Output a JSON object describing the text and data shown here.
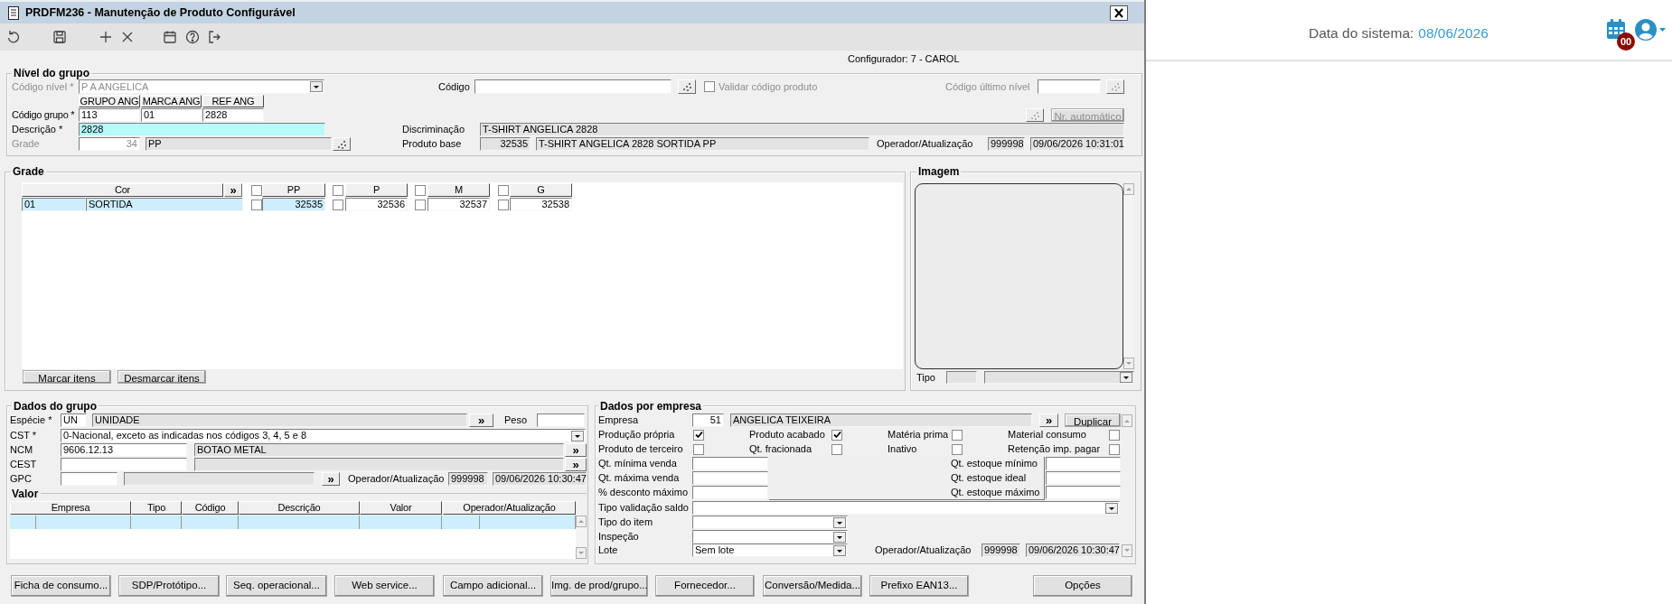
{
  "window": {
    "title": "PRDFM236 - Manutenção de Produto Configurável"
  },
  "toolbar": [
    {
      "kind": "undo"
    },
    {
      "kind": "save"
    },
    {
      "kind": "add"
    },
    {
      "kind": "delete"
    },
    {
      "kind": "calendar"
    },
    {
      "kind": "help"
    },
    {
      "kind": "exit"
    }
  ],
  "configurador": "Configurador: 7 - CAROL",
  "nivel_do_grupo": {
    "title": "Nível do grupo",
    "codigo_nivel": {
      "label": "Código nível *",
      "value": "P A ANGELICA",
      "disabled": true
    },
    "codigo": {
      "label": "Código"
    },
    "validar_codigo_produto": {
      "label": "Validar código produto",
      "checked": false,
      "disabled": true
    },
    "codigo_ultimo_nivel": {
      "label": "Código último nível",
      "disabled": true
    },
    "codigo_grupo": {
      "label": "Código grupo *",
      "columns": [
        "GRUPO ANG",
        "MARCA ANG",
        "REF ANG"
      ],
      "values": [
        "113",
        "01",
        "2828"
      ]
    },
    "nr_automatico": {
      "label": "Nr. automático",
      "disabled": true
    },
    "descricao": {
      "label": "Descrição *",
      "value": "2828"
    },
    "discriminacao": {
      "label": "Discriminação",
      "value": "T-SHIRT ANGELICA 2828"
    },
    "grade": {
      "label": "Grade",
      "code": "34",
      "name": "PP",
      "disabled": true
    },
    "produto_base": {
      "label": "Produto base",
      "code": "32535",
      "name": "T-SHIRT ANGELICA 2828 SORTIDA PP"
    },
    "operador_atualizacao": {
      "label": "Operador/Atualização",
      "operator": "999998",
      "timestamp": "09/06/2026 10:31:01"
    }
  },
  "grade": {
    "title": "Grade",
    "expand": "»",
    "columns": [
      {
        "kind": "color",
        "label": "Cor"
      },
      {
        "kind": "size",
        "label": "PP",
        "checked": false
      },
      {
        "kind": "size",
        "label": "P",
        "checked": false
      },
      {
        "kind": "size",
        "label": "M",
        "checked": false
      },
      {
        "kind": "size",
        "label": "G",
        "checked": false
      }
    ],
    "rows": [
      {
        "code": "01",
        "name": "SORTIDA",
        "selected": true,
        "cells": [
          {
            "value": "32535",
            "checked": false,
            "selected": true
          },
          {
            "value": "32536",
            "checked": false,
            "selected": false
          },
          {
            "value": "32537",
            "checked": false,
            "selected": false
          },
          {
            "value": "32538",
            "checked": false,
            "selected": false
          }
        ]
      }
    ],
    "buttons": [
      "Marcar itens",
      "Desmarcar itens"
    ]
  },
  "imagem": {
    "title": "Imagem",
    "tipo": {
      "label": "Tipo"
    }
  },
  "dados_do_grupo": {
    "title": "Dados do grupo",
    "especie": {
      "label": "Espécie *",
      "code": "UN",
      "name": "UNIDADE",
      "expand": "»"
    },
    "peso": {
      "label": "Peso"
    },
    "cst": {
      "label": "CST *",
      "value": "0-Nacional, exceto as indicadas nos códigos 3, 4, 5 e 8"
    },
    "ncm": {
      "label": "NCM",
      "code": "9606.12.13",
      "name": "BOTAO METAL",
      "expand": "»"
    },
    "cest": {
      "label": "CEST",
      "expand": "»"
    },
    "gpc": {
      "label": "GPC",
      "expand": "»"
    },
    "operador_atualizacao": {
      "label": "Operador/Atualização",
      "operator": "999998",
      "timestamp": "09/06/2026 10:30:47"
    }
  },
  "valor": {
    "title": "Valor",
    "columns": [
      "Empresa",
      "Tipo",
      "Código",
      "Descrição",
      "Valor",
      "Operador/Atualização"
    ],
    "rows": [
      {
        "selected": true
      }
    ]
  },
  "dados_por_empresa": {
    "title": "Dados por empresa",
    "empresa": {
      "label": "Empresa",
      "code": "51",
      "name": "ANGELICA TEIXEIRA",
      "expand": "»"
    },
    "duplicar": "Duplicar",
    "flags": [
      {
        "label": "Produção própria",
        "checked": true
      },
      {
        "label": "Produto acabado",
        "checked": true
      },
      {
        "label": "Matéria prima",
        "checked": false
      },
      {
        "label": "Material consumo",
        "checked": false
      },
      {
        "label": "Produto de terceiro",
        "checked": false
      },
      {
        "label": "Qt. fracionada",
        "checked": false
      },
      {
        "label": "Inativo",
        "checked": false
      },
      {
        "label": "Retenção imp. pagar",
        "checked": false
      }
    ],
    "limits": [
      {
        "label": "Qt. mínima venda"
      },
      {
        "label": "Qt. máxima venda"
      },
      {
        "label": "% desconto máximo"
      }
    ],
    "stock": [
      {
        "label": "Qt. estoque mínimo"
      },
      {
        "label": "Qt. estoque ideal"
      },
      {
        "label": "Qt. estoque máximo"
      }
    ],
    "tipo_validacao_saldo": {
      "label": "Tipo validação saldo"
    },
    "tipo_do_item": {
      "label": "Tipo do item"
    },
    "inspecao": {
      "label": "Inspeção"
    },
    "lote": {
      "label": "Lote",
      "value": "Sem lote"
    },
    "operador_atualizacao": {
      "label": "Operador/Atualização",
      "operator": "999998",
      "timestamp": "09/06/2026 10:30:47"
    }
  },
  "actions": [
    "Ficha de consumo...",
    "SDP/Protótipo...",
    "Seq. operacional...",
    "Web service...",
    "Campo adicional...",
    "Img. de prod/grupo...",
    "Fornecedor...",
    "Conversão/Medida...",
    "Prefixo EAN13..."
  ],
  "opcoes": "Opções",
  "system_header": {
    "label": "Data do sistema:",
    "date": "08/06/2026",
    "calendar_badge": "00"
  }
}
